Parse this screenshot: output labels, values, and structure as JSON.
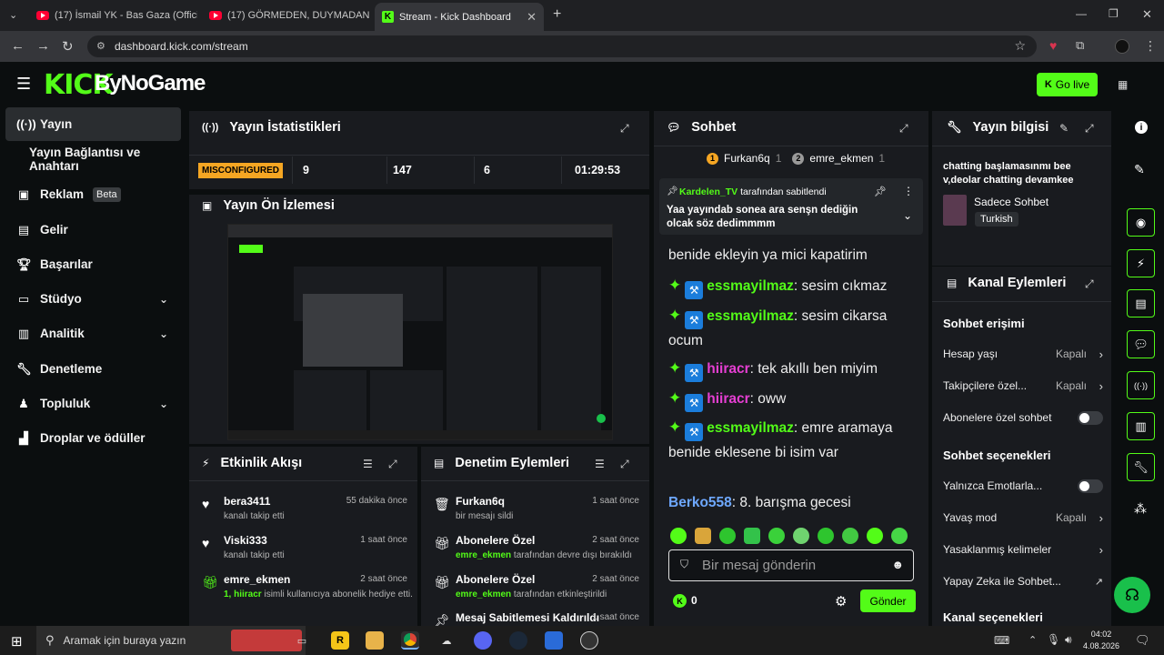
{
  "browser": {
    "tabs": [
      {
        "title": "(17) İsmail YK - Bas Gaza (Offici"
      },
      {
        "title": "(17) GÖRMEDEN, DUYMADAN"
      },
      {
        "title": "Stream - Kick Dashboard"
      }
    ],
    "url": "dashboard.kick.com/stream"
  },
  "header": {
    "logo_kick": "KICK",
    "logo_by": "ByNoGame",
    "go_live": "Go live"
  },
  "sidebar": {
    "items": [
      {
        "label": "Yayın"
      },
      {
        "label": "Yayın Bağlantısı ve Anahtarı"
      },
      {
        "label": "Reklam",
        "badge": "Beta"
      },
      {
        "label": "Gelir"
      },
      {
        "label": "Başarılar"
      },
      {
        "label": "Stüdyo"
      },
      {
        "label": "Analitik"
      },
      {
        "label": "Denetleme"
      },
      {
        "label": "Topluluk"
      },
      {
        "label": "Droplar ve ödüller"
      }
    ]
  },
  "stats": {
    "title": "Yayın İstatistikleri",
    "status": "MISCONFIGURED",
    "values": [
      "9",
      "147",
      "6",
      "01:29:53"
    ]
  },
  "preview": {
    "title": "Yayın Ön İzlemesi"
  },
  "activity": {
    "title": "Etkinlik Akışı",
    "items": [
      {
        "name": "bera3411",
        "sub": "kanalı takip etti",
        "time": "55 dakika önce"
      },
      {
        "name": "Viski333",
        "sub": "kanalı takip etti",
        "time": "1 saat önce"
      },
      {
        "name": "emre_ekmen",
        "sub_highlight": "1, hiiracr",
        "sub": " isimli kullanıcıya abonelik hediye etti.",
        "time": "2 saat önce"
      }
    ]
  },
  "moderation": {
    "title": "Denetim Eylemleri",
    "items": [
      {
        "name": "Furkan6q",
        "sub": "bir mesajı sildi",
        "time": "1 saat önce"
      },
      {
        "name": "Abonelere Özel",
        "sub_highlight": "emre_ekmen",
        "sub": " tarafından devre dışı bırakıldı",
        "time": "2 saat önce"
      },
      {
        "name": "Abonelere Özel",
        "sub_highlight": "emre_ekmen",
        "sub": " tarafından etkinleştirildi",
        "time": "2 saat önce"
      },
      {
        "name": "Mesaj Sabitlemesi Kaldırıldı",
        "time": "1 saat önce"
      }
    ]
  },
  "chat": {
    "title": "Sohbet",
    "top_users": [
      {
        "name": "Furkan6q",
        "count": "1"
      },
      {
        "name": "emre_ekmen",
        "count": "1"
      }
    ],
    "pinned": {
      "by_user": "Kardelen_TV",
      "by_text": " tarafından sabitlendi",
      "message": "Yaa yayındab sonea ara senşn dediğin olcak söz dedimmmm"
    },
    "messages": [
      {
        "user": "",
        "text": "benide ekleyin ya mici kapatirim"
      },
      {
        "user": "essmayilmaz",
        "text": ": sesim cıkmaz"
      },
      {
        "user": "essmayilmaz",
        "text": ": sesim cikarsa ocum"
      },
      {
        "user": "hiiracr",
        "text": ": tek akıllı ben miyim"
      },
      {
        "user": "hiiracr",
        "text": ": oww"
      },
      {
        "user": "essmayilmaz",
        "text": ": emre aramaya benide eklesene bi isim var"
      },
      {
        "user": "Berko558",
        "text": ": 8. barışma gecesi"
      }
    ],
    "input_placeholder": "Bir mesaj gönderin",
    "points": "0",
    "send": "Gönder"
  },
  "stream_info": {
    "title": "Yayın bilgisi",
    "stream_title": "chatting başlamasınmı bee v,deolar chatting devamkee",
    "category": "Sadece Sohbet",
    "language": "Turkish"
  },
  "channel_actions": {
    "title": "Kanal Eylemleri",
    "section_access": "Sohbet erişimi",
    "access_rows": [
      {
        "label": "Hesap yaşı",
        "value": "Kapalı",
        "type": "arrow"
      },
      {
        "label": "Takipçilere özel...",
        "value": "Kapalı",
        "type": "arrow"
      },
      {
        "label": "Abonelere özel sohbet",
        "value": "",
        "type": "toggle"
      }
    ],
    "section_options": "Sohbet seçenekleri",
    "option_rows": [
      {
        "label": "Yalnızca Emotlarla...",
        "value": "",
        "type": "toggle"
      },
      {
        "label": "Yavaş mod",
        "value": "Kapalı",
        "type": "arrow"
      },
      {
        "label": "Yasaklanmış kelimeler",
        "value": "",
        "type": "arrow"
      },
      {
        "label": "Yapay Zeka ile Sohbet...",
        "value": "",
        "type": "ext"
      }
    ],
    "section_more": "Kanal seçenekleri"
  },
  "taskbar": {
    "search_placeholder": "Aramak için buraya yazın",
    "time": "04:02",
    "date": "4.08.2026"
  },
  "colors": {
    "accent": "#53fc18",
    "panel": "#191b1f",
    "bg": "#0b0e0f",
    "warning": "#f5a623"
  }
}
